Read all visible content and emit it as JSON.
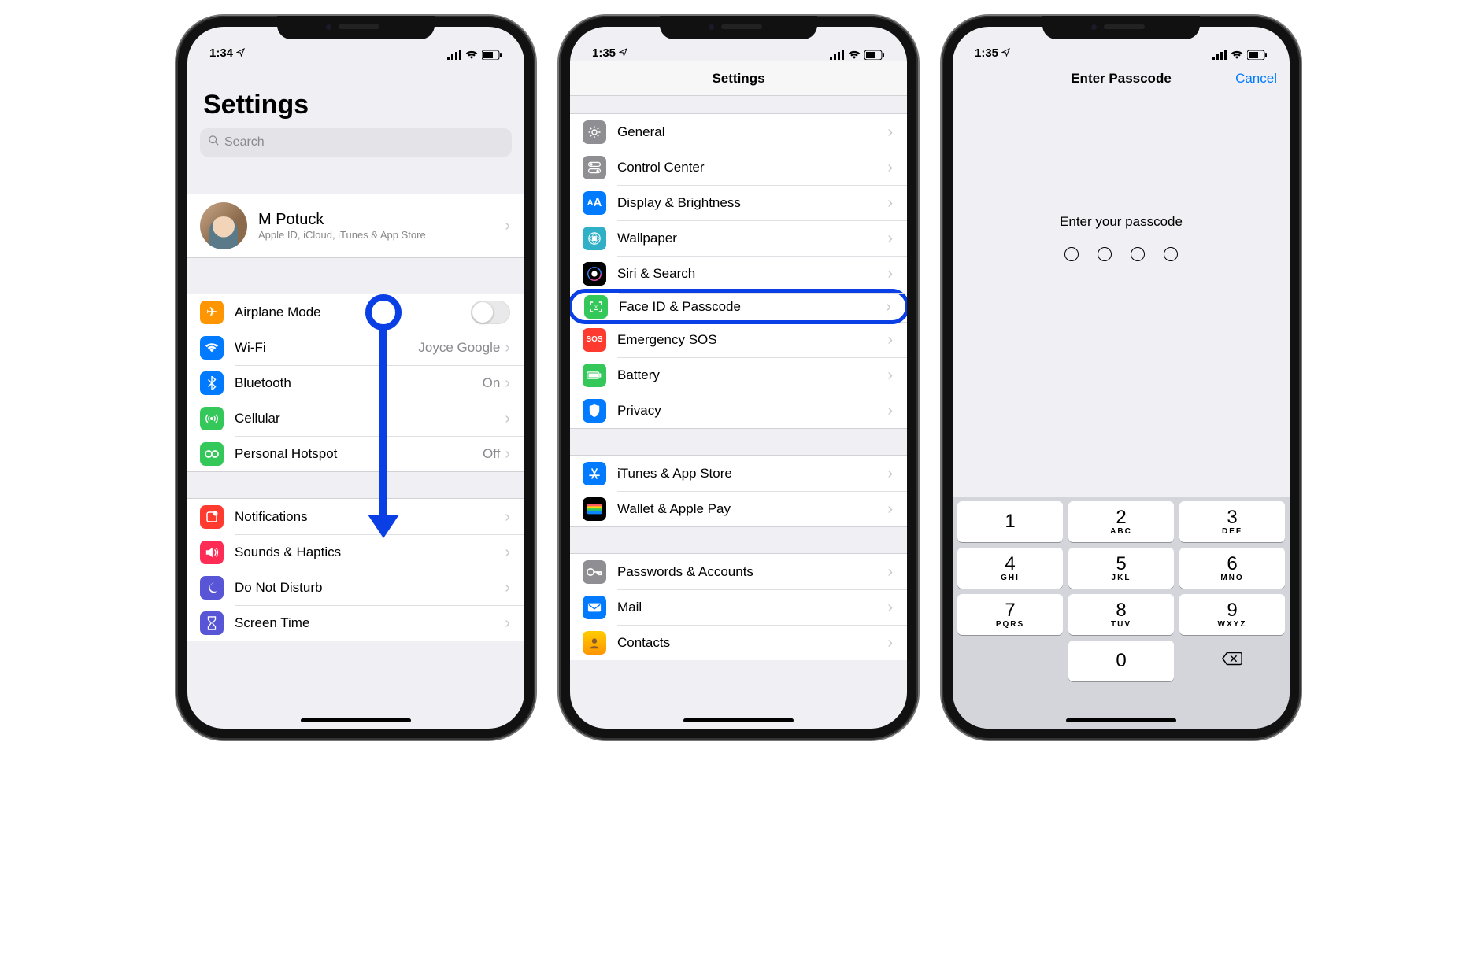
{
  "status": {
    "time1": "1:34",
    "time2": "1:35",
    "time3": "1:35",
    "loc_icon": "✈︎"
  },
  "s1": {
    "title": "Settings",
    "search_placeholder": "Search",
    "apple": {
      "name": "M Potuck",
      "sub": "Apple ID, iCloud, iTunes & App Store"
    },
    "airplane": "Airplane Mode",
    "wifi": "Wi-Fi",
    "wifi_val": "Joyce Google",
    "bluetooth": "Bluetooth",
    "bluetooth_val": "On",
    "cellular": "Cellular",
    "hotspot": "Personal Hotspot",
    "hotspot_val": "Off",
    "notifications": "Notifications",
    "sounds": "Sounds & Haptics",
    "dnd": "Do Not Disturb",
    "screentime": "Screen Time"
  },
  "s2": {
    "title": "Settings",
    "general": "General",
    "control": "Control Center",
    "display": "Display & Brightness",
    "wallpaper": "Wallpaper",
    "siri": "Siri & Search",
    "faceid": "Face ID & Passcode",
    "sos": "Emergency SOS",
    "sos_icon": "SOS",
    "battery": "Battery",
    "privacy": "Privacy",
    "itunes": "iTunes & App Store",
    "wallet": "Wallet & Apple Pay",
    "passwords": "Passwords & Accounts",
    "mail": "Mail",
    "contacts": "Contacts"
  },
  "s3": {
    "title": "Enter Passcode",
    "cancel": "Cancel",
    "prompt": "Enter your passcode",
    "keys": [
      {
        "n": "1",
        "l": ""
      },
      {
        "n": "2",
        "l": "ABC"
      },
      {
        "n": "3",
        "l": "DEF"
      },
      {
        "n": "4",
        "l": "GHI"
      },
      {
        "n": "5",
        "l": "JKL"
      },
      {
        "n": "6",
        "l": "MNO"
      },
      {
        "n": "7",
        "l": "PQRS"
      },
      {
        "n": "8",
        "l": "TUV"
      },
      {
        "n": "9",
        "l": "WXYZ"
      },
      {
        "n": "0",
        "l": ""
      }
    ]
  }
}
